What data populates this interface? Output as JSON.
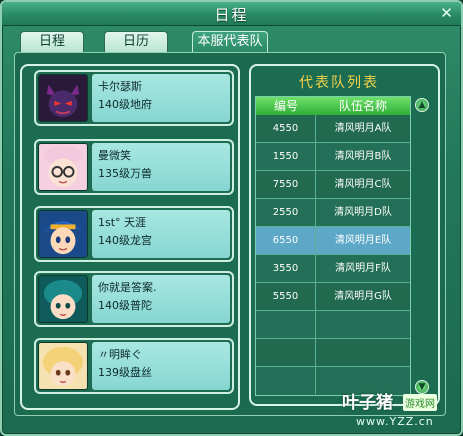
{
  "window": {
    "title": "日程",
    "close_glyph": "✕"
  },
  "tabs": [
    {
      "label": "日程",
      "active": false
    },
    {
      "label": "日历",
      "active": false
    },
    {
      "label": "本服代表队",
      "active": true
    }
  ],
  "members": [
    {
      "name": "卡尔瑟斯",
      "level": "140级地府",
      "portrait_icon": "dark-demon-portrait-icon"
    },
    {
      "name": "曼微笑",
      "level": "135级万兽",
      "portrait_icon": "glasses-girl-portrait-icon"
    },
    {
      "name": "1st° 天涯",
      "level": "140级龙宫",
      "portrait_icon": "blue-hair-boy-portrait-icon"
    },
    {
      "name": "你就是答案.",
      "level": "140级普陀",
      "portrait_icon": "teal-hair-girl-portrait-icon"
    },
    {
      "name": "〃明眸ぐ",
      "level": "139级盘丝",
      "portrait_icon": "blonde-girl-portrait-icon"
    }
  ],
  "team_list": {
    "title": "代表队列表",
    "columns": [
      "编号",
      "队伍名称"
    ],
    "rows": [
      {
        "code": "4550",
        "name": "清风明月A队",
        "selected": false
      },
      {
        "code": "1550",
        "name": "清风明月B队",
        "selected": false
      },
      {
        "code": "7550",
        "name": "清风明月C队",
        "selected": false
      },
      {
        "code": "2550",
        "name": "清风明月D队",
        "selected": false
      },
      {
        "code": "6550",
        "name": "清风明月E队",
        "selected": true
      },
      {
        "code": "3550",
        "name": "清风明月F队",
        "selected": false
      },
      {
        "code": "5550",
        "name": "清风明月G队",
        "selected": false
      }
    ]
  },
  "watermark": {
    "main": "叶子猪",
    "box": "游戏网",
    "url": "www.YZZ.cn"
  },
  "colors": {
    "title_gold": "#f5d24a",
    "selected_row": "#5da7c7",
    "header_green": "#2fae36"
  }
}
